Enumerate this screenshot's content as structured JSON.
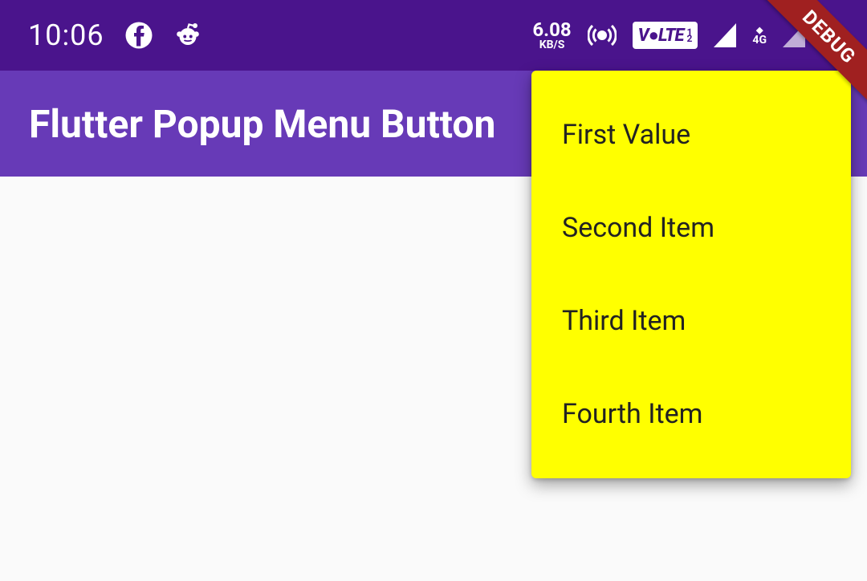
{
  "status_bar": {
    "time": "10:06",
    "network": {
      "speed_value": "6.08",
      "speed_unit": "KB/S"
    },
    "volte_label": "V●LTE",
    "signal_4g": "4G"
  },
  "app_bar": {
    "title": "Flutter Popup Menu Button"
  },
  "popup_menu": {
    "items": [
      {
        "label": "First Value"
      },
      {
        "label": "Second Item"
      },
      {
        "label": "Third Item"
      },
      {
        "label": "Fourth Item"
      }
    ]
  },
  "debug_banner": "DEBUG",
  "colors": {
    "status_bar": "#4a148c",
    "app_bar": "#673ab7",
    "popup_bg": "#ffff00",
    "debug_banner": "#a02020"
  }
}
